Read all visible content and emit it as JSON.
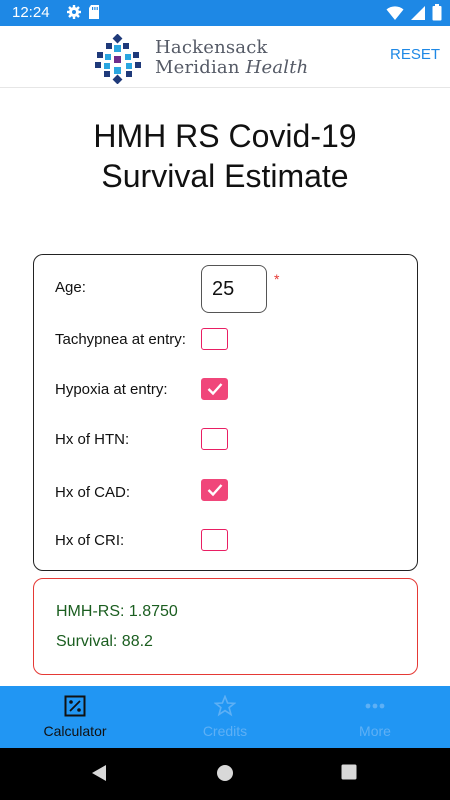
{
  "status_bar": {
    "time": "12:24",
    "left_icons": [
      "gear-icon",
      "sd-card-icon"
    ],
    "right_icons": [
      "wifi-icon",
      "signal-icon",
      "battery-icon"
    ]
  },
  "app_bar": {
    "logo_line1": "Hackensack",
    "logo_line2_a": "Meridian",
    "logo_line2_b": "Health",
    "reset_label": "RESET",
    "accent_color": "#1e88e5"
  },
  "title": {
    "line1": "HMH RS Covid-19",
    "line2": "Survival Estimate"
  },
  "form": {
    "age": {
      "label": "Age:",
      "value": "25",
      "required_mark": "*"
    },
    "fields": [
      {
        "label": "Tachypnea at entry:",
        "checked": false
      },
      {
        "label": "Hypoxia at entry:",
        "checked": true
      },
      {
        "label": "Hx of HTN:",
        "checked": false
      },
      {
        "label": "Hx of CAD:",
        "checked": true
      },
      {
        "label": "Hx of CRI:",
        "checked": false
      }
    ],
    "checkbox_color": "#f0467a"
  },
  "result": {
    "score": "HMH-RS: 1.8750",
    "survival": "Survival: 88.2",
    "border_color": "#e53935",
    "text_color": "#1b5e20"
  },
  "bottom_nav": {
    "items": [
      {
        "label": "Calculator",
        "icon": "percent-calculator-icon",
        "active": true
      },
      {
        "label": "Credits",
        "icon": "star-icon",
        "active": false
      },
      {
        "label": "More",
        "icon": "more-dots-icon",
        "active": false
      }
    ],
    "background": "#2196f3"
  },
  "system_nav": {
    "buttons": [
      "back-icon",
      "home-icon",
      "recents-icon"
    ]
  }
}
